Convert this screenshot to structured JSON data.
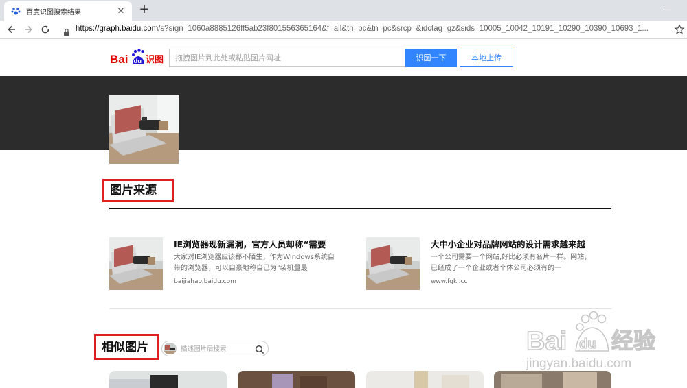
{
  "browser": {
    "tab_title": "百度识图搜索结果",
    "url_host": "https://graph.baidu.com",
    "url_rest": "/s?sign=1060a8885126ff5ab23f801556365164&f=all&tn=pc&tn=pc&srcp=&idctag=gz&sids=10005_10042_10191_10290_10390_10693_1..."
  },
  "header": {
    "logo_text_a": "Bai",
    "logo_text_b": "du",
    "logo_text_c": "识图",
    "search_placeholder": "拖拽图片到此处或粘贴图片网址",
    "search_button": "识图一下",
    "upload_button": "本地上传"
  },
  "source_section": {
    "title": "图片来源",
    "cards": [
      {
        "title": "IE浏览器现新漏洞，官方人员却称“需要",
        "desc": "大家对IE浏览器应该都不陌生，作为Windows系统自带的浏览器，可以自豪地称自己为\"装机量最",
        "site": "baijiahao.baidu.com"
      },
      {
        "title": "大中小企业对品牌网站的设计需求越来越",
        "desc": "一个公司需要一个网站,好比必须有名片一样。网站，已经成了一个企业或者个体公司必须有的一",
        "site": "www.fgkj.cc"
      }
    ]
  },
  "similar_section": {
    "title": "相似图片",
    "search_placeholder": "描述图片后搜索"
  },
  "watermark": {
    "line1": "Bai",
    "line1b": "du",
    "line1c": "经验",
    "line2": "jingyan.baidu.com"
  },
  "colors": {
    "accent": "#3385ff",
    "highlight_box": "#e02020",
    "dark_band": "#2c2c2c"
  }
}
